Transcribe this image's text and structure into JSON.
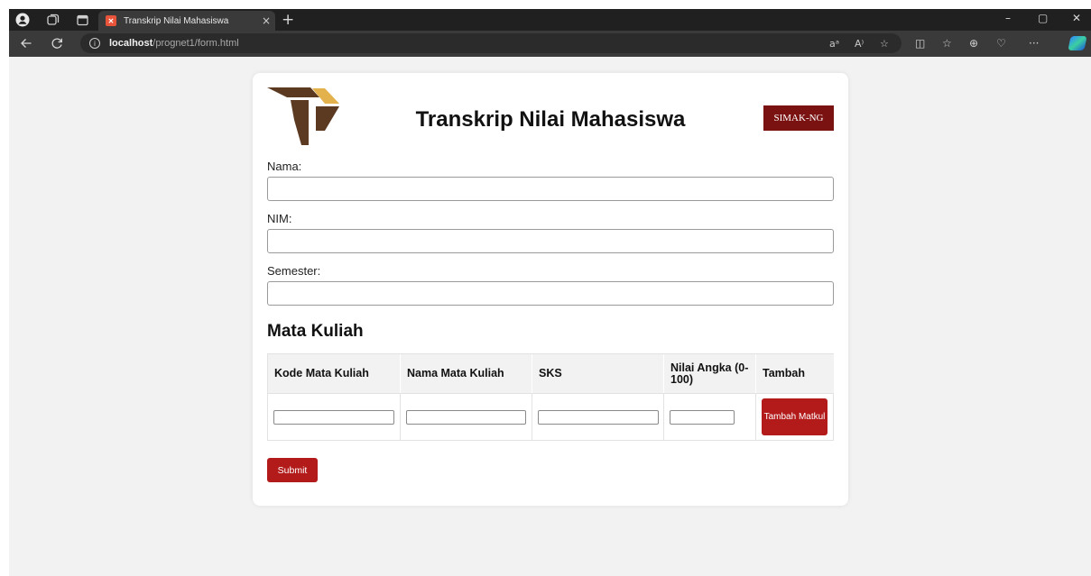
{
  "browser": {
    "tab_title": "Transkrip Nilai Mahasiswa",
    "tab_close": "×",
    "new_tab": "+",
    "url_host": "localhost",
    "url_path": "/prognet1/form.html",
    "window_minimize": "–",
    "window_restore": "▢",
    "window_close": "✕",
    "more_label": "···"
  },
  "header": {
    "title": "Transkrip Nilai Mahasiswa",
    "badge": "SIMAK-NG",
    "logo_colors": {
      "dark": "#5b3a21",
      "light": "#e3b24d"
    }
  },
  "form": {
    "nama_label": "Nama:",
    "nama_value": "",
    "nim_label": "NIM:",
    "nim_value": "",
    "semester_label": "Semester:",
    "semester_value": ""
  },
  "courses": {
    "section_title": "Mata Kuliah",
    "columns": [
      "Kode Mata Kuliah",
      "Nama Mata Kuliah",
      "SKS",
      "Nilai Angka (0-100)",
      "Tambah"
    ],
    "add_button": "Tambah Matkul"
  },
  "submit_label": "Submit",
  "colors": {
    "accent": "#b31b1b",
    "badge": "#7b1212",
    "page_bg": "#f2f2f2"
  }
}
